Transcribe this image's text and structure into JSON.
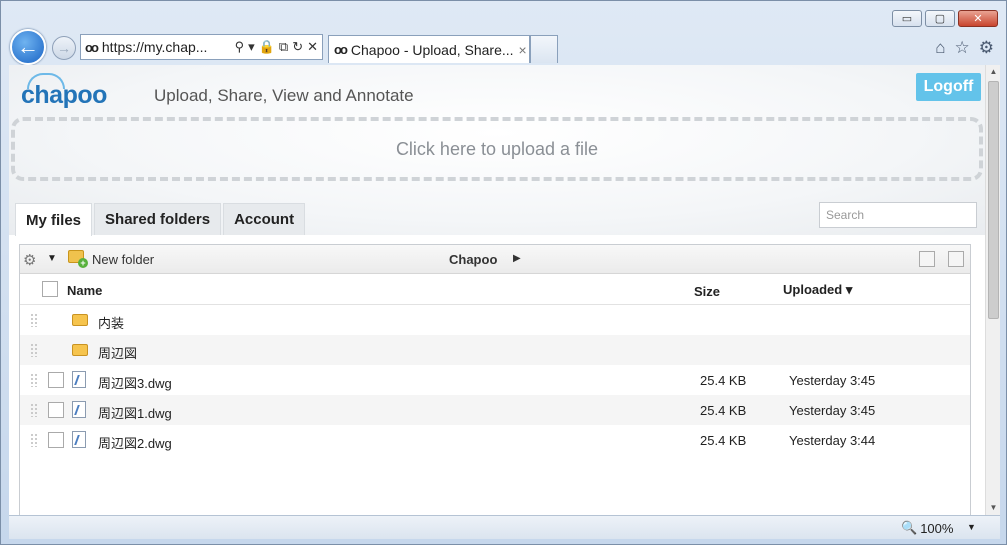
{
  "browser": {
    "address": "https://my.chap...",
    "tab_title": "Chapoo - Upload, Share...",
    "tab_close": "×",
    "zoom": "100%"
  },
  "page": {
    "logo": "chapoo",
    "tagline": "Upload, Share, View and Annotate",
    "logoff_label": "Logoff",
    "upload_prompt": "Click here to upload a file",
    "tabs": [
      {
        "label": "My files",
        "active": true
      },
      {
        "label": "Shared folders",
        "active": false
      },
      {
        "label": "Account",
        "active": false
      }
    ],
    "search_placeholder": "Search"
  },
  "toolbar": {
    "new_folder_label": "New folder",
    "breadcrumb": "Chapoo"
  },
  "table": {
    "columns": {
      "name": "Name",
      "size": "Size",
      "uploaded": "Uploaded"
    },
    "rows": [
      {
        "type": "folder",
        "name": "内装",
        "size": "",
        "uploaded": ""
      },
      {
        "type": "folder",
        "name": "周辺図",
        "size": "",
        "uploaded": ""
      },
      {
        "type": "file",
        "name": "周辺図3.dwg",
        "size": "25.4 KB",
        "uploaded": "Yesterday 3:45"
      },
      {
        "type": "file",
        "name": "周辺図1.dwg",
        "size": "25.4 KB",
        "uploaded": "Yesterday 3:45"
      },
      {
        "type": "file",
        "name": "周辺図2.dwg",
        "size": "25.4 KB",
        "uploaded": "Yesterday 3:44"
      }
    ]
  },
  "colors": {
    "accent": "#63c3ea",
    "logo": "#2374b8",
    "folder": "#f6c44d"
  }
}
